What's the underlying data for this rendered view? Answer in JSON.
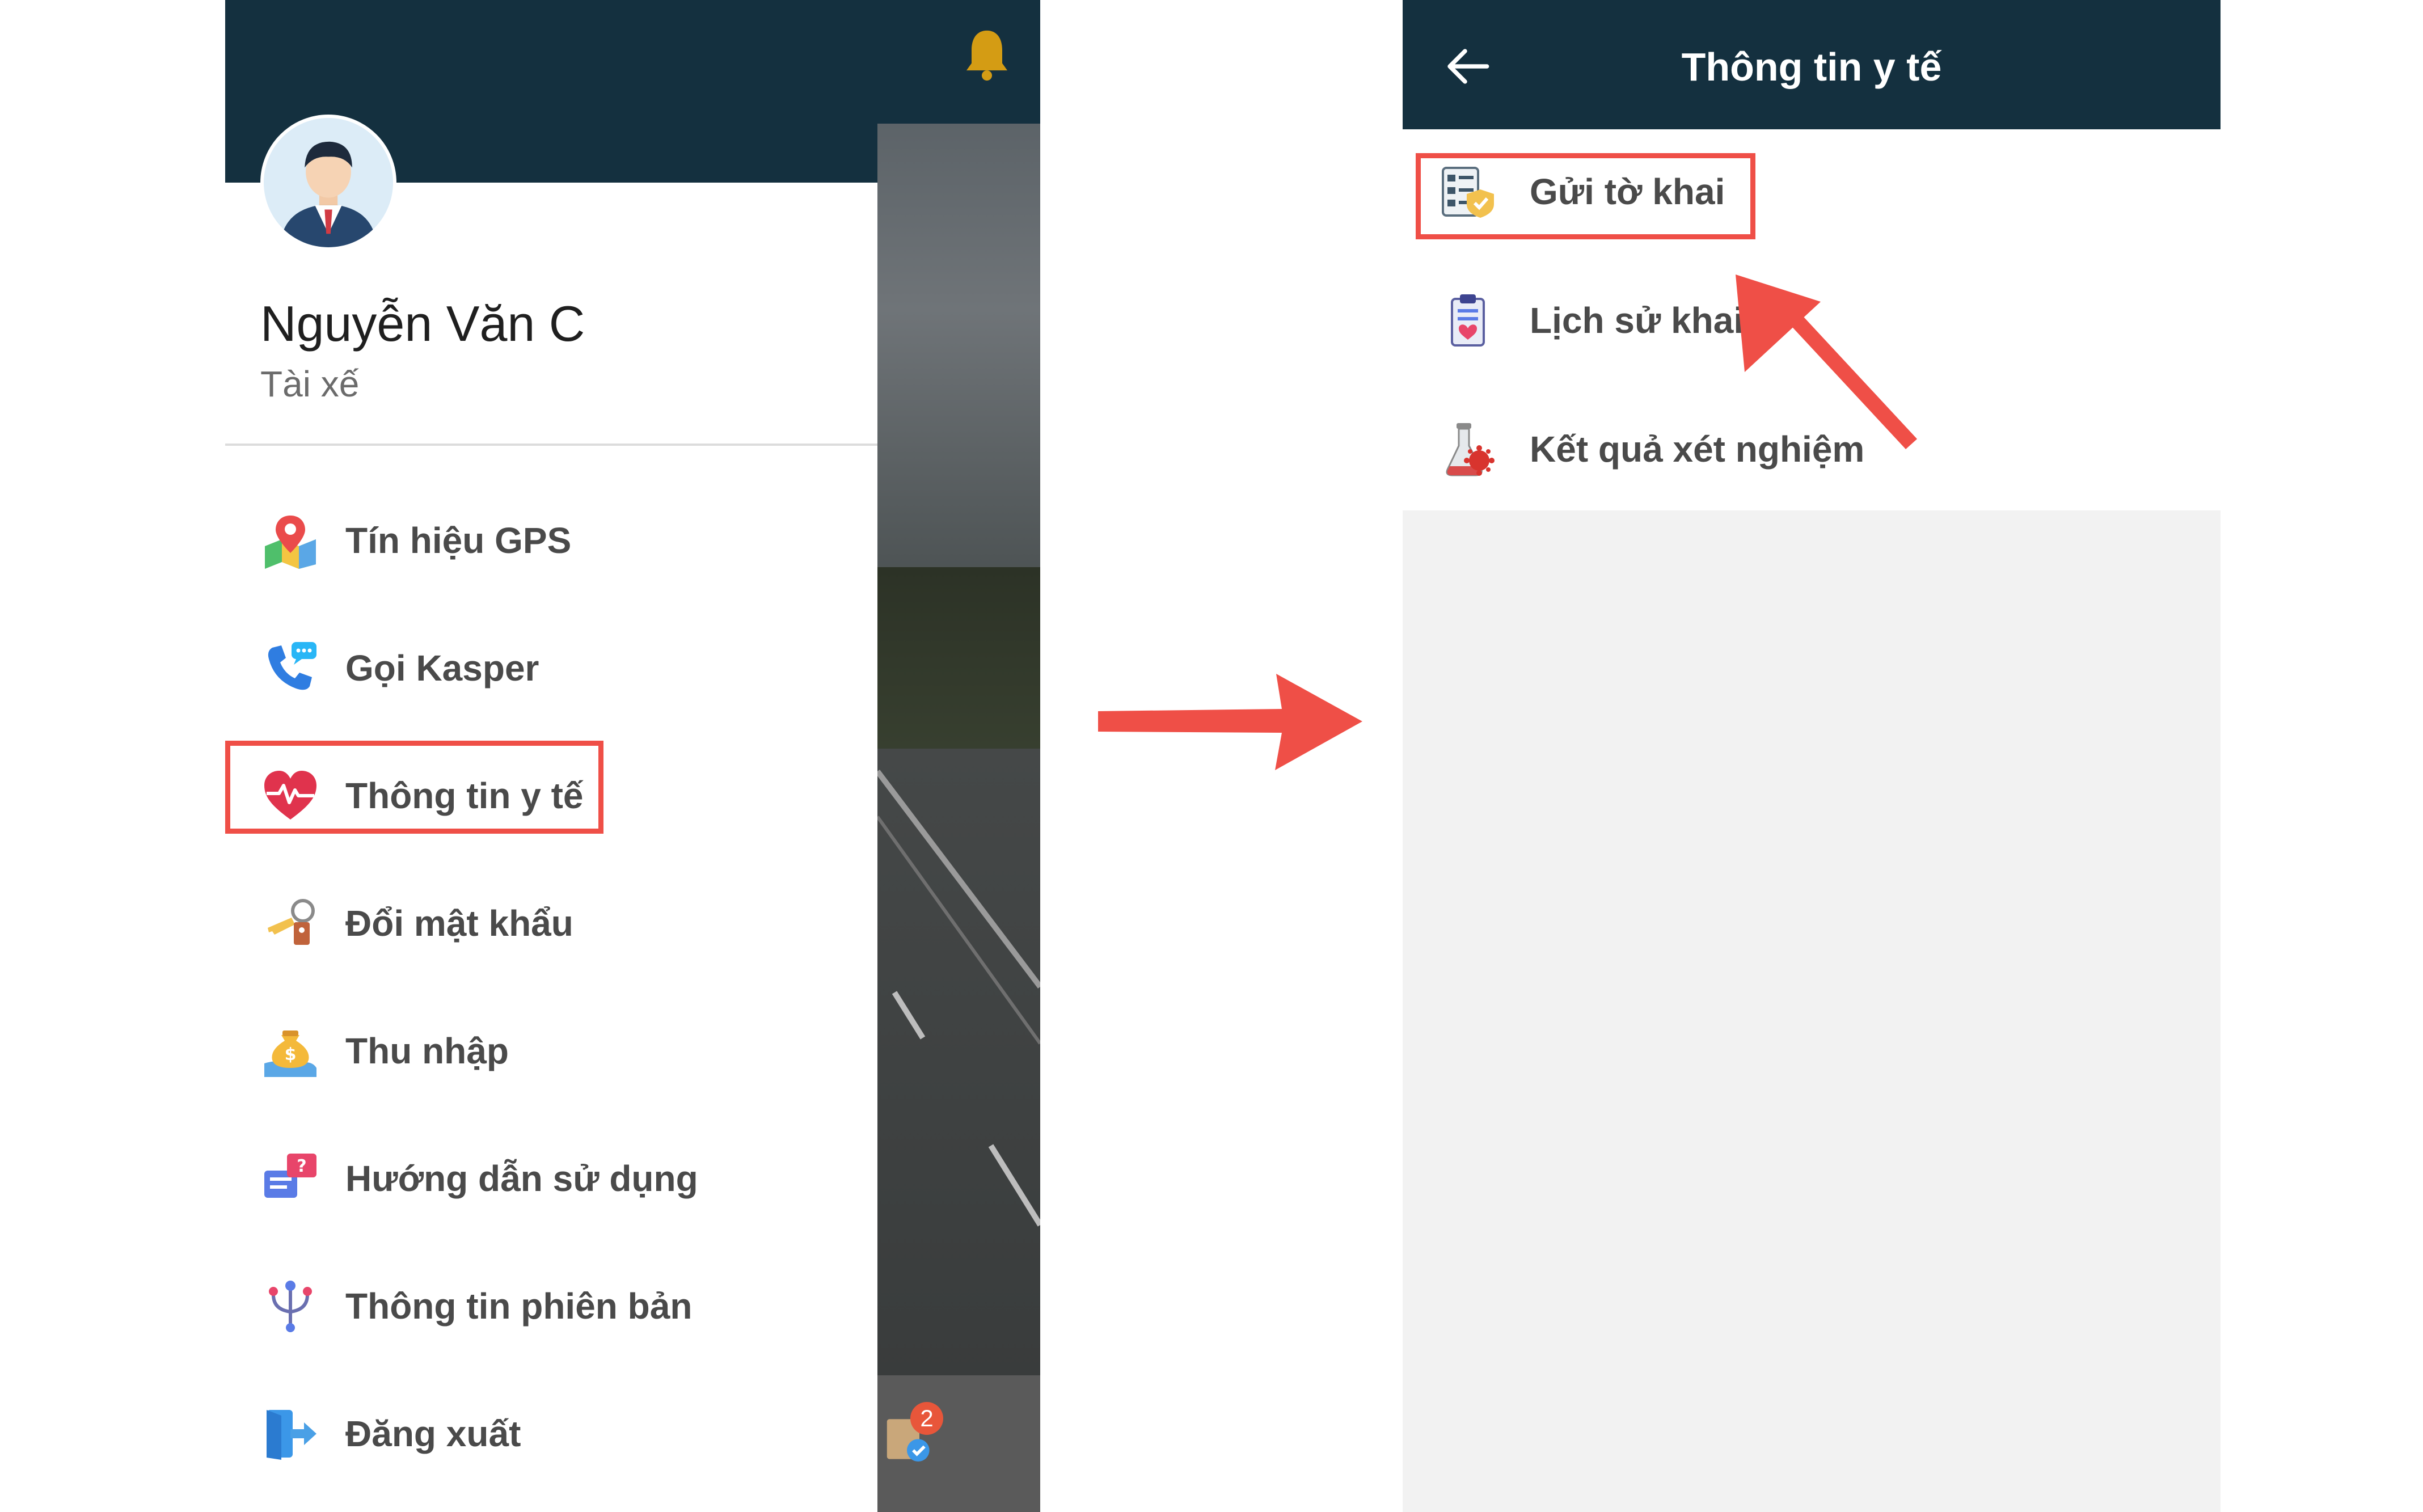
{
  "drawer": {
    "user_name": "Nguyễn Văn C",
    "user_role": "Tài xế",
    "menu": [
      {
        "label": "Tín hiệu GPS",
        "icon": "map-pin-icon"
      },
      {
        "label": "Gọi Kasper",
        "icon": "phone-chat-icon"
      },
      {
        "label": "Thông tin y tế",
        "icon": "heart-pulse-icon",
        "highlighted": true
      },
      {
        "label": "Đổi mật khẩu",
        "icon": "key-icon"
      },
      {
        "label": "Thu nhập",
        "icon": "money-bag-icon"
      },
      {
        "label": "Hướng dẫn sử dụng",
        "icon": "help-chat-icon"
      },
      {
        "label": "Thông tin phiên bản",
        "icon": "version-branch-icon"
      },
      {
        "label": "Đăng xuất",
        "icon": "logout-icon"
      }
    ]
  },
  "background_app": {
    "bell_icon": "bell-icon",
    "badge_count": "2"
  },
  "health_screen": {
    "title": "Thông tin y tế",
    "back_icon": "back-arrow-icon",
    "items": [
      {
        "label": "Gửi tờ khai",
        "icon": "declaration-form-icon",
        "highlighted": true
      },
      {
        "label": "Lịch sử khai b",
        "icon": "history-clipboard-icon"
      },
      {
        "label": "Kết quả xét nghiệm",
        "icon": "test-tube-virus-icon"
      }
    ]
  },
  "colors": {
    "header": "#14303f",
    "annotation": "#ef4f47",
    "text": "#4a4a4a"
  }
}
